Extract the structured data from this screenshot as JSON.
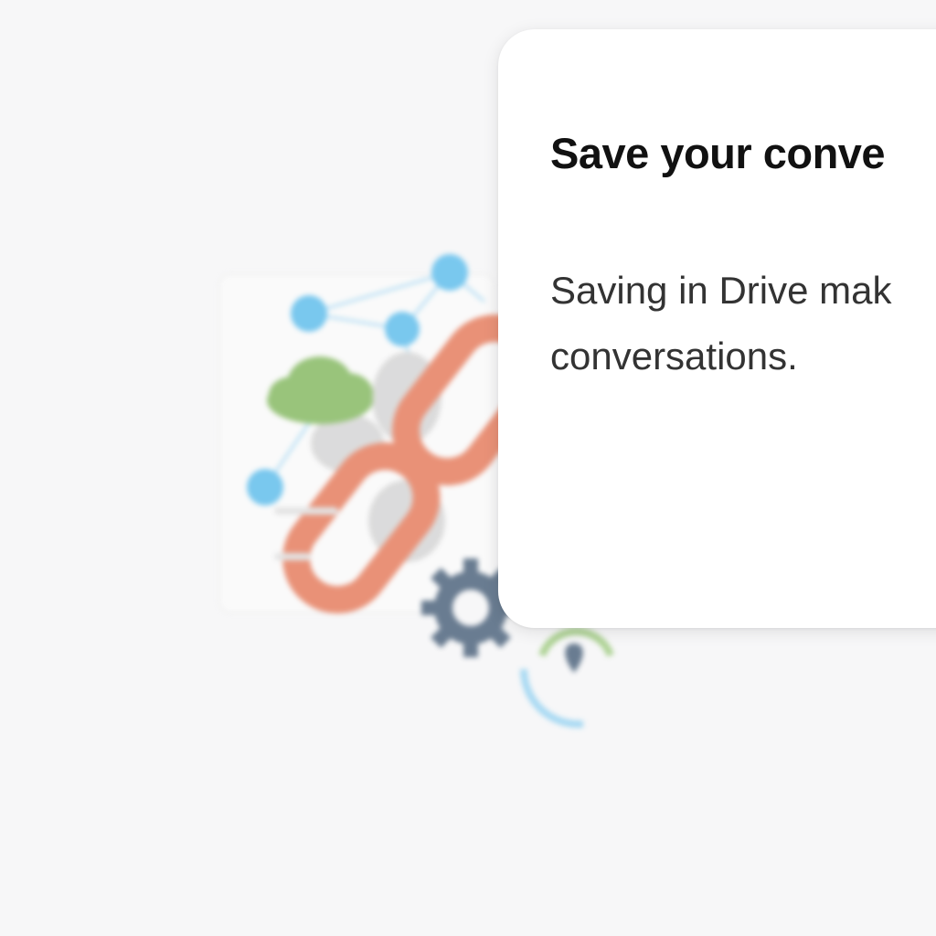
{
  "dialog": {
    "title": "Save your conve",
    "body_line1": "Saving in Drive mak",
    "body_line2": "conversations."
  },
  "colors": {
    "background": "#f7f7f8",
    "dialog_background": "#ffffff",
    "link_orange": "#e8876a",
    "node_blue": "#6cc3ee",
    "cloud_green": "#8fbf6e",
    "gear_slate": "#5a6f86"
  },
  "icons": [
    "link-icon",
    "cloud-icon",
    "gear-icon",
    "network-icon",
    "location-pin-icon"
  ]
}
